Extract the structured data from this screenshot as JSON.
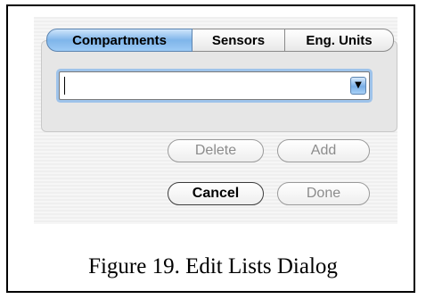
{
  "tabs": [
    {
      "label": "Compartments",
      "selected": true
    },
    {
      "label": "Sensors",
      "selected": false
    },
    {
      "label": "Eng. Units",
      "selected": false
    }
  ],
  "combo": {
    "value": "",
    "icon": "chevron-down-icon"
  },
  "buttons": {
    "delete_label": "Delete",
    "add_label": "Add",
    "cancel_label": "Cancel",
    "done_label": "Done"
  },
  "caption": "Figure 19.  Edit Lists Dialog",
  "colors": {
    "accent": "#7fb5ea",
    "disabled_text": "#8c8c8c"
  }
}
